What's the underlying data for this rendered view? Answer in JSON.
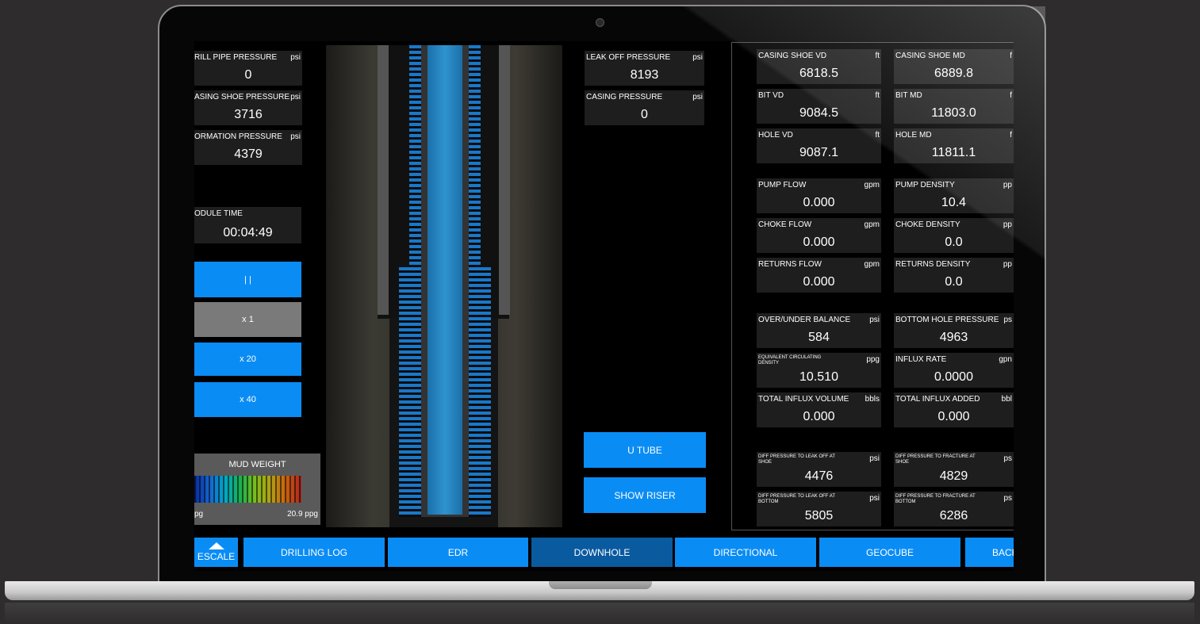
{
  "left_panels": [
    {
      "label": "RILL PIPE PRESSURE",
      "unit": "psi",
      "value": "0"
    },
    {
      "label": "ASING SHOE PRESSURE",
      "unit": "psi",
      "value": "3716"
    },
    {
      "label": "ORMATION PRESSURE",
      "unit": "psi",
      "value": "4379"
    }
  ],
  "module_time": {
    "label": "ODULE TIME",
    "value": "00:04:49"
  },
  "speed_buttons": {
    "pause": "| |",
    "x1": "x 1",
    "x20": "x 20",
    "x40": "x 40"
  },
  "mud_weight": {
    "title": "MUD WEIGHT",
    "min_label": "pg",
    "max_label": "20.9 ppg"
  },
  "center_panels": [
    {
      "label": "LEAK OFF PRESSURE",
      "unit": "psi",
      "value": "8193"
    },
    {
      "label": "CASING PRESSURE",
      "unit": "psi",
      "value": "0"
    }
  ],
  "action_buttons": {
    "u_tube": "U TUBE",
    "show_riser": "SHOW RISER"
  },
  "right_panels": {
    "depth": [
      {
        "label": "CASING SHOE VD",
        "unit": "ft",
        "value": "6818.5"
      },
      {
        "label": "CASING SHOE MD",
        "unit": "f",
        "value": "6889.8"
      },
      {
        "label": "BIT VD",
        "unit": "ft",
        "value": "9084.5"
      },
      {
        "label": "BIT MD",
        "unit": "f",
        "value": "11803.0"
      },
      {
        "label": "HOLE VD",
        "unit": "ft",
        "value": "9087.1"
      },
      {
        "label": "HOLE MD",
        "unit": "f",
        "value": "11811.1"
      }
    ],
    "flow": [
      {
        "label": "PUMP FLOW",
        "unit": "gpm",
        "value": "0.000"
      },
      {
        "label": "PUMP DENSITY",
        "unit": "pp",
        "value": "10.4"
      },
      {
        "label": "CHOKE FLOW",
        "unit": "gpm",
        "value": "0.000"
      },
      {
        "label": "CHOKE DENSITY",
        "unit": "pp",
        "value": "0.0"
      },
      {
        "label": "RETURNS FLOW",
        "unit": "gpm",
        "value": "0.000"
      },
      {
        "label": "RETURNS DENSITY",
        "unit": "pp",
        "value": "0.0"
      }
    ],
    "balance": [
      {
        "label": "OVER/UNDER BALANCE",
        "unit": "psi",
        "value": "584"
      },
      {
        "label": "BOTTOM HOLE PRESSURE",
        "unit": "ps",
        "value": "4963"
      },
      {
        "label": "EQUIVALENT CIRCULATING DENSITY",
        "unit": "ppg",
        "value": "10.510"
      },
      {
        "label": "INFLUX RATE",
        "unit": "gpn",
        "value": "0.0000"
      },
      {
        "label": "TOTAL INFLUX VOLUME",
        "unit": "bbls",
        "value": "0.000"
      },
      {
        "label": "TOTAL INFLUX ADDED",
        "unit": "bbl",
        "value": "0.000"
      }
    ],
    "diff": [
      {
        "label": "DIFF PRESSURE TO LEAK OFF AT SHOE",
        "unit": "psi",
        "value": "4476"
      },
      {
        "label": "DIFF PRESSURE TO FRACTURE AT SHOE",
        "unit": "ps",
        "value": "4829"
      },
      {
        "label": "DIFF PRESSURE TO LEAK OFF AT BOTTOM",
        "unit": "psi",
        "value": "5805"
      },
      {
        "label": "DIFF PRESSURE TO FRACTURE AT BOTTOM",
        "unit": "ps",
        "value": "6286"
      }
    ]
  },
  "bottom_nav": {
    "escale": "ESCALE",
    "tabs": [
      "DRILLING LOG",
      "EDR",
      "DOWNHOLE",
      "DIRECTIONAL",
      "GEOCUBE",
      "BACK"
    ]
  },
  "colors": {
    "accent": "#0a8cf5",
    "active_tab": "#0a5aa0",
    "panel_bg": "#1e1e1e"
  }
}
